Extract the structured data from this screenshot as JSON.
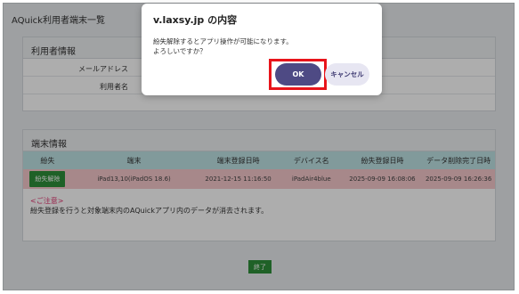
{
  "app": {
    "title": "AQuick利用者端末一覧"
  },
  "user_info": {
    "title": "利用者情報",
    "rows": [
      {
        "label": "メールアドレス",
        "value": ""
      },
      {
        "label": "利用者名",
        "value": ""
      }
    ]
  },
  "device_info": {
    "title": "端末情報",
    "columns": [
      "紛失",
      "端末",
      "端末登録日時",
      "デバイス名",
      "紛失登録日時",
      "データ削除完了日時"
    ],
    "rows": [
      {
        "action": "紛失解除",
        "device": "iPad13,10(iPadOS 18.6)",
        "registered": "2021-12-15 11:16:50",
        "device_name": "iPadAir4blue",
        "lost_registered": "2025-09-09 16:08:06",
        "data_deleted": "2025-09-09 16:26:36"
      }
    ]
  },
  "notice": {
    "title": "<ご注意>",
    "body": "紛失登録を行うと対象端末内のAQuickアプリ内のデータが消去されます。"
  },
  "end_button": "終了",
  "dialog": {
    "title": "v.laxsy.jp の内容",
    "message_line1": "紛失解除するとアプリ操作が可能になります。",
    "message_line2": "よろしいですか？",
    "ok": "OK",
    "cancel": "キャンセル"
  },
  "colors": {
    "overlay": "#000000",
    "accent": "#4e4a84",
    "highlight_border": "#e8141b",
    "lost_row": "#f6c9cc",
    "table_header": "#bfe3e5",
    "green_button": "#2f8f3a",
    "notice_red": "#e0316d"
  }
}
